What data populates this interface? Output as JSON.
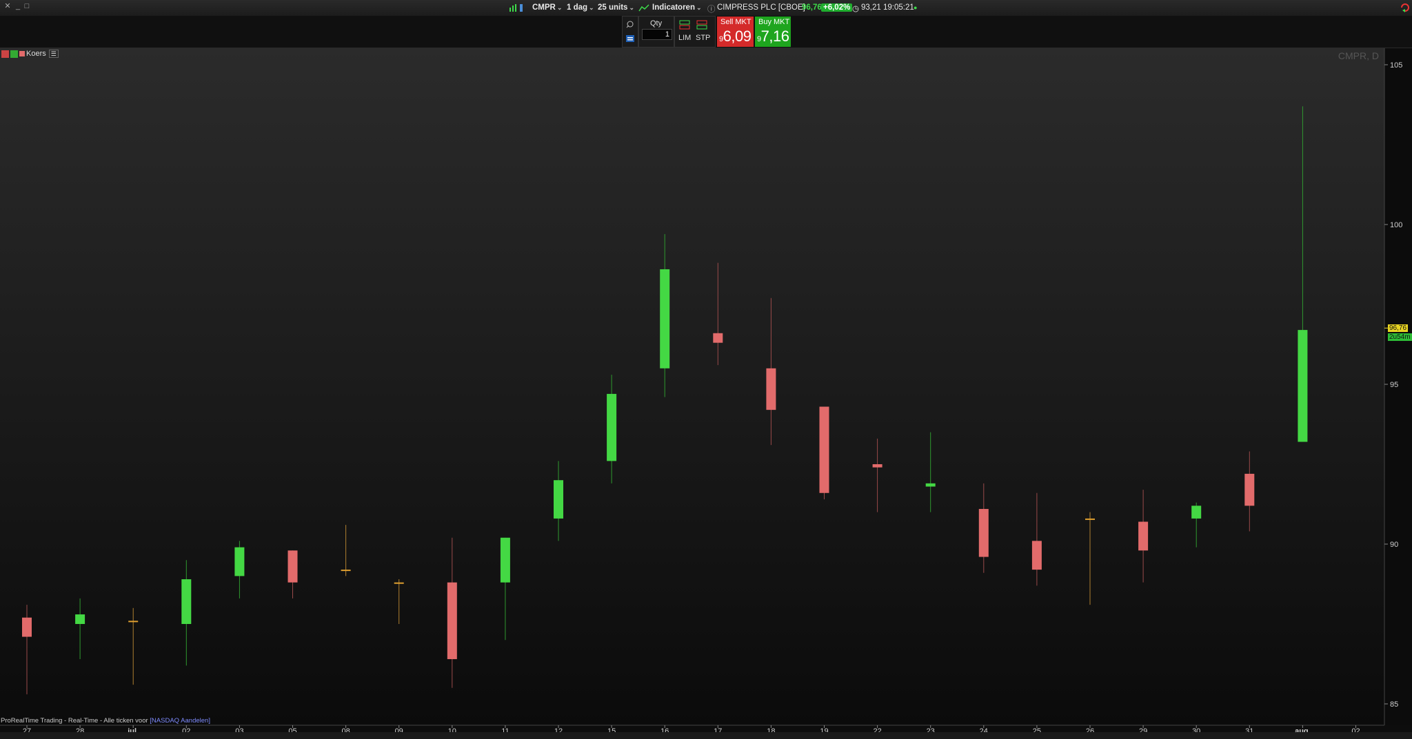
{
  "topbar": {
    "close": "✕",
    "minimize": "_",
    "maximize": "□",
    "ticker": "CMPR",
    "interval": "1 dag",
    "units": "25 units",
    "indicators": "Indicatoren",
    "instrument": "CIMPRESS PLC [CBOE]",
    "last": "96,76",
    "change": "+6,02%",
    "time_value": "93,21 19:05:21"
  },
  "order_bar": {
    "qty_label": "Qty",
    "qty_value": "1",
    "lim": "LIM",
    "stp": "STP",
    "sell_label": "Sell MKT",
    "sell_prefix": "9",
    "sell_price": "6,09",
    "buy_label": "Buy MKT",
    "buy_prefix": "9",
    "buy_price": "7,16"
  },
  "legend_label": "Koers",
  "watermark": "CMPR, D",
  "footer": {
    "text": "ProRealTime Trading - Real-Time - Alle ticken voor ",
    "link": "[NASDAQ Aandelen]"
  },
  "price_label": "96,76",
  "countdown_label": "2u54m",
  "colors": {
    "up": "#44d844",
    "down": "#e26b6b",
    "doji": "#e0a030",
    "bg": "#0d0d0d"
  },
  "chart_data": {
    "type": "candlestick",
    "title": "CMPR, D",
    "ylim": [
      84,
      106
    ],
    "y_ticks": [
      85,
      90,
      95,
      100,
      105
    ],
    "x_labels": [
      "27",
      "28",
      "jul.",
      "02",
      "03",
      "05",
      "08",
      "09",
      "10",
      "11",
      "12",
      "15",
      "16",
      "17",
      "18",
      "19",
      "22",
      "23",
      "24",
      "25",
      "26",
      "29",
      "30",
      "31",
      "aug.",
      "02"
    ],
    "candles": [
      {
        "date": "27",
        "open": 87.7,
        "high": 88.1,
        "low": 85.3,
        "close": 87.1
      },
      {
        "date": "28",
        "open": 87.5,
        "high": 88.3,
        "low": 86.4,
        "close": 87.8
      },
      {
        "date": "jul.",
        "open": 87.6,
        "high": 88.0,
        "low": 85.6,
        "close": 87.6
      },
      {
        "date": "02",
        "open": 87.5,
        "high": 89.5,
        "low": 86.2,
        "close": 88.9
      },
      {
        "date": "03",
        "open": 89.0,
        "high": 90.1,
        "low": 88.3,
        "close": 89.9
      },
      {
        "date": "05",
        "open": 89.8,
        "high": 89.8,
        "low": 88.3,
        "close": 88.8
      },
      {
        "date": "08",
        "open": 89.2,
        "high": 90.6,
        "low": 89.0,
        "close": 89.2
      },
      {
        "date": "09",
        "open": 88.8,
        "high": 88.9,
        "low": 87.5,
        "close": 88.8
      },
      {
        "date": "10",
        "open": 88.8,
        "high": 90.2,
        "low": 85.5,
        "close": 86.4
      },
      {
        "date": "11",
        "open": 88.8,
        "high": 90.2,
        "low": 87.0,
        "close": 90.2
      },
      {
        "date": "12",
        "open": 90.8,
        "high": 92.6,
        "low": 90.1,
        "close": 92.0
      },
      {
        "date": "15",
        "open": 92.6,
        "high": 95.3,
        "low": 91.9,
        "close": 94.7
      },
      {
        "date": "16",
        "open": 95.5,
        "high": 99.7,
        "low": 94.6,
        "close": 98.6
      },
      {
        "date": "17",
        "open": 96.6,
        "high": 98.8,
        "low": 95.6,
        "close": 96.3
      },
      {
        "date": "18",
        "open": 95.5,
        "high": 97.7,
        "low": 93.1,
        "close": 94.2
      },
      {
        "date": "19",
        "open": 94.3,
        "high": 94.3,
        "low": 91.4,
        "close": 91.6
      },
      {
        "date": "22",
        "open": 92.5,
        "high": 93.3,
        "low": 91.0,
        "close": 92.4
      },
      {
        "date": "23",
        "open": 91.8,
        "high": 93.5,
        "low": 91.0,
        "close": 91.9
      },
      {
        "date": "24",
        "open": 91.1,
        "high": 91.9,
        "low": 89.1,
        "close": 89.6
      },
      {
        "date": "25",
        "open": 90.1,
        "high": 91.6,
        "low": 88.7,
        "close": 89.2
      },
      {
        "date": "26",
        "open": 90.8,
        "high": 91.0,
        "low": 88.1,
        "close": 90.8
      },
      {
        "date": "29",
        "open": 90.7,
        "high": 91.7,
        "low": 88.8,
        "close": 89.8
      },
      {
        "date": "30",
        "open": 90.8,
        "high": 91.3,
        "low": 89.9,
        "close": 91.2
      },
      {
        "date": "31",
        "open": 92.2,
        "high": 92.9,
        "low": 90.4,
        "close": 91.2
      },
      {
        "date": "aug.",
        "open": 93.2,
        "high": 103.7,
        "low": 93.2,
        "close": 96.7
      }
    ]
  }
}
